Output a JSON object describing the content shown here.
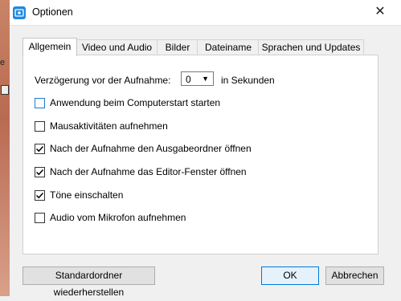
{
  "background_fragment": {
    "letter": "e"
  },
  "window": {
    "title": "Optionen",
    "close_glyph": "✕",
    "app_icon": "screen-capture-icon"
  },
  "tabs": [
    {
      "label": "Allgemein",
      "active": true
    },
    {
      "label": "Video und Audio",
      "active": false
    },
    {
      "label": "Bilder",
      "active": false
    },
    {
      "label": "Dateiname",
      "active": false
    },
    {
      "label": "Sprachen und Updates",
      "active": false
    }
  ],
  "general": {
    "delay_label": "Verzögerung vor der Aufnahme:",
    "delay_value": "0",
    "delay_unit": "in Sekunden",
    "options": [
      {
        "label": "Anwendung beim Computerstart starten",
        "checked": false
      },
      {
        "label": "Mausaktivitäten aufnehmen",
        "checked": false
      },
      {
        "label": "Nach der Aufnahme den Ausgabeordner öffnen",
        "checked": true
      },
      {
        "label": "Nach der Aufnahme das Editor-Fenster öffnen",
        "checked": true
      },
      {
        "label": "Töne einschalten",
        "checked": true
      },
      {
        "label": "Audio vom Mikrofon aufnehmen",
        "checked": false
      }
    ]
  },
  "footer": {
    "restore_label": "Standardordner wiederherstellen",
    "ok_label": "OK",
    "cancel_label": "Abbrechen"
  },
  "colors": {
    "accent": "#0078d7",
    "focus_checkbox": "#1e7ad2"
  }
}
